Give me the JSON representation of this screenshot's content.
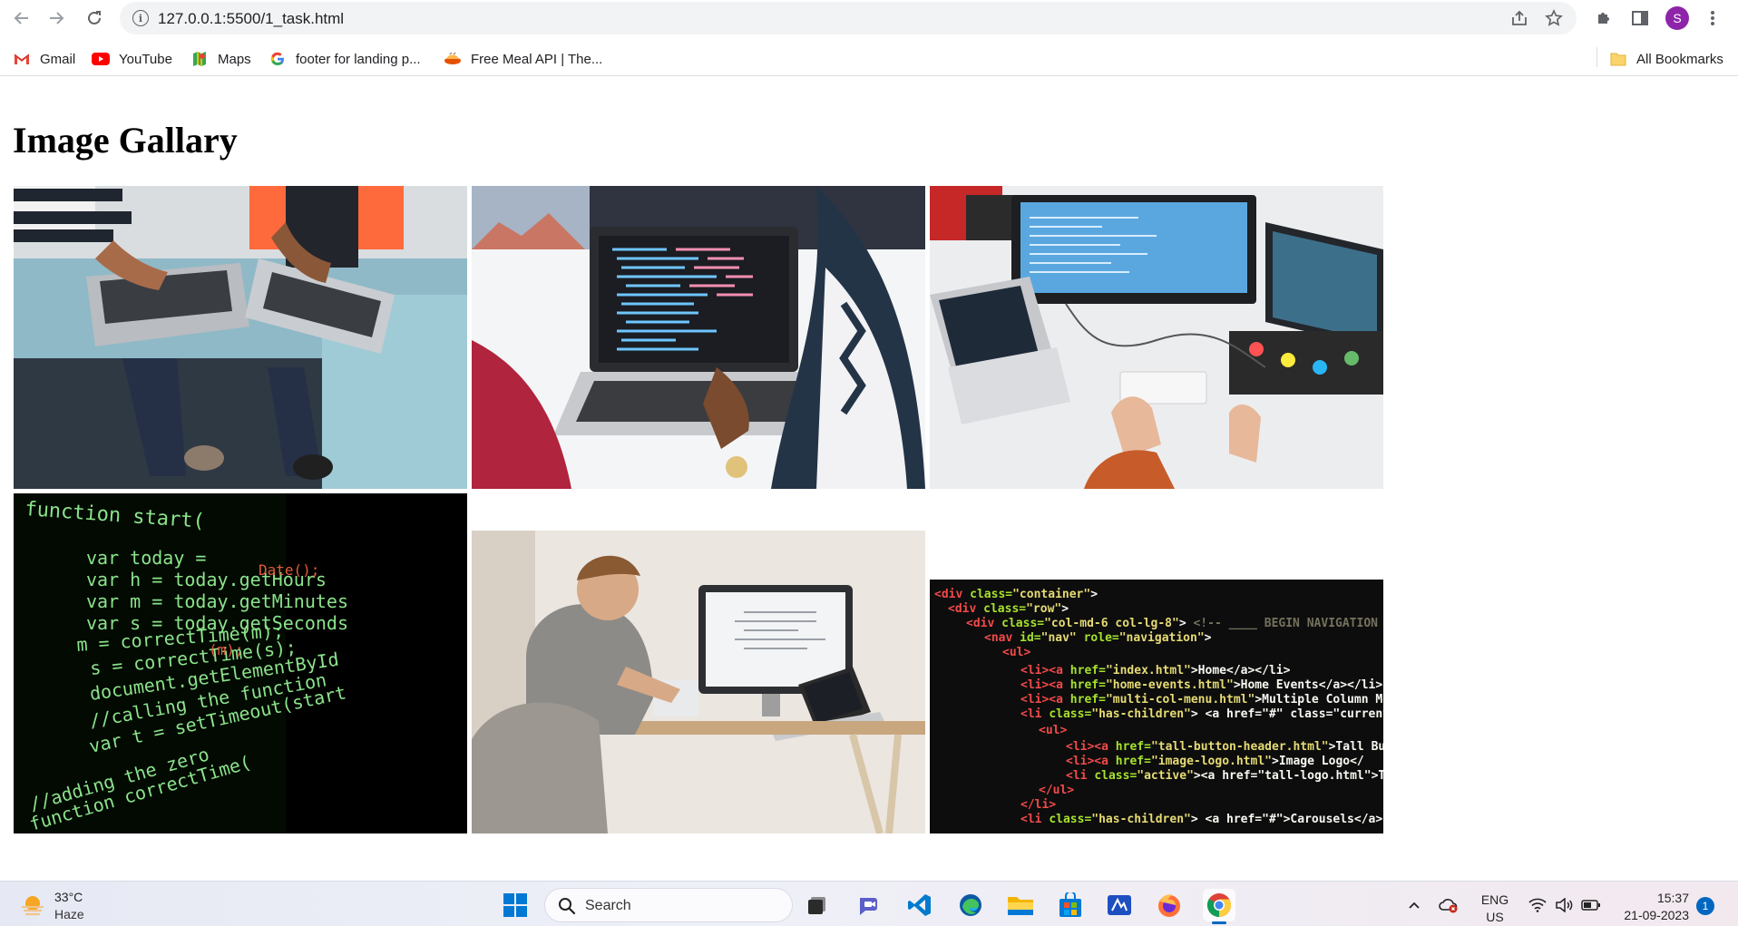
{
  "browser": {
    "url": "127.0.0.1:5500/1_task.html",
    "profile_initial": "S"
  },
  "bookmarks": {
    "items": [
      {
        "label": "Gmail",
        "icon": "gmail-icon"
      },
      {
        "label": "YouTube",
        "icon": "youtube-icon"
      },
      {
        "label": "Maps",
        "icon": "maps-icon"
      },
      {
        "label": "footer for landing p...",
        "icon": "google-icon"
      },
      {
        "label": "Free Meal API | The...",
        "icon": "meal-icon"
      }
    ],
    "all_bookmarks_label": "All Bookmarks"
  },
  "page": {
    "title": "Image Gallary",
    "images": [
      {
        "name": "two-people-with-laptops-photo"
      },
      {
        "name": "laptop-code-window-photo"
      },
      {
        "name": "desk-monitors-top-view-photo"
      },
      {
        "name": "green-code-function-photo"
      },
      {
        "name": "man-at-desk-computer-photo"
      },
      {
        "name": "html-code-screen-photo"
      }
    ]
  },
  "taskbar": {
    "weather_temp": "33°C",
    "weather_desc": "Haze",
    "search_placeholder": "Search",
    "language_line1": "ENG",
    "language_line2": "US",
    "time": "15:37",
    "date": "21-09-2023",
    "notification_count": "1"
  },
  "colors": {
    "profile": "#8e24aa",
    "taskbar_accent": "#0067c0"
  }
}
